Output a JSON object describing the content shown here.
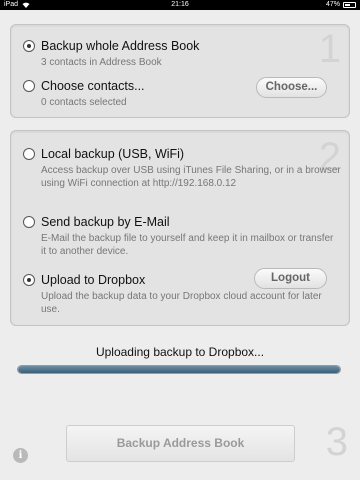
{
  "status_bar": {
    "carrier": "iPad",
    "time": "21:16",
    "battery": "47%"
  },
  "section1": {
    "step_number": "1",
    "options": [
      {
        "label": "Backup whole Address Book",
        "subtitle": "3 contacts in Address Book",
        "selected": true
      },
      {
        "label": "Choose contacts...",
        "subtitle": "0 contacts selected",
        "selected": false
      }
    ],
    "choose_button": "Choose..."
  },
  "section2": {
    "step_number": "2",
    "options": [
      {
        "label": "Local backup (USB, WiFi)",
        "subtitle": "Access backup over USB using iTunes File Sharing, or in a browser using WiFi connection at http://192.168.0.12",
        "selected": false
      },
      {
        "label": "Send backup by E-Mail",
        "subtitle": "E-Mail the backup file to yourself and keep it in mailbox or transfer it to another device.",
        "selected": false
      },
      {
        "label": "Upload to Dropbox",
        "subtitle": "Upload the backup data to your Dropbox cloud account for later use.",
        "selected": true
      }
    ],
    "logout_button": "Logout"
  },
  "progress": {
    "label": "Uploading backup to Dropbox...",
    "percent": 100
  },
  "footer": {
    "main_button": "Backup Address Book",
    "step_number": "3",
    "info_icon": "i"
  },
  "colors": {
    "background": "#ededed",
    "progress_fill": "#3b5d78"
  }
}
